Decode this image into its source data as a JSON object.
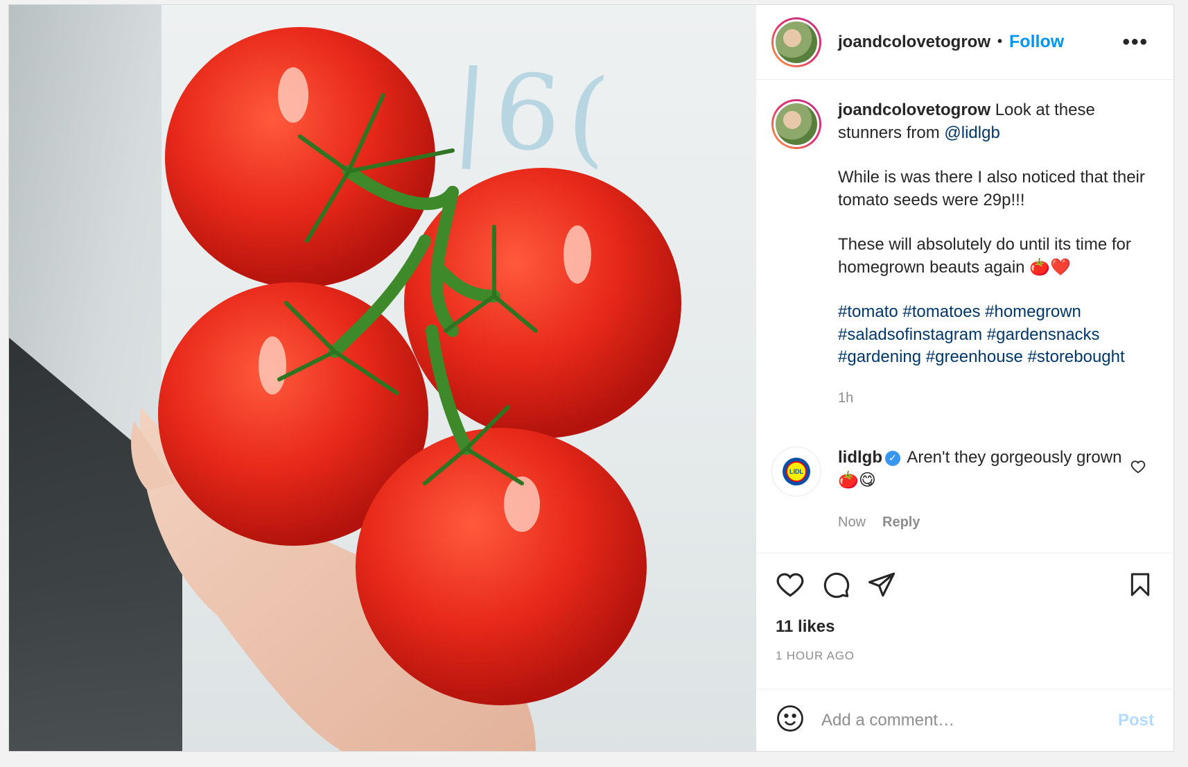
{
  "header": {
    "username": "joandcolovetogrow",
    "separator": "•",
    "follow_label": "Follow",
    "more_label": "•••"
  },
  "caption": {
    "username": "joandcolovetogrow",
    "line1": "Look at these stunners from",
    "mention": "@lidlgb",
    "para2": "While is was there I also noticed that their tomato seeds were 29p!!!",
    "para3": "These will absolutely do until its time for homegrown beauts again 🍅❤️",
    "hashtags": "#tomato #tomatoes #homegrown #saladsofinstagram #gardensnacks #gardening #greenhouse #storebought",
    "time": "1h"
  },
  "comment": {
    "username": "lidlgb",
    "verified_icon": "✓",
    "text": "Aren't they gorgeously grown 🍅😋",
    "time": "Now",
    "reply_label": "Reply",
    "avatar_text": "LIDL"
  },
  "actions": {
    "likes": "11 likes",
    "ago": "1 HOUR AGO"
  },
  "add_comment": {
    "placeholder": "Add a comment…",
    "post_label": "Post"
  },
  "colors": {
    "follow": "#0095f6",
    "link": "#00376b",
    "post_disabled": "#b3dbff",
    "tomato": "#e8291a"
  }
}
